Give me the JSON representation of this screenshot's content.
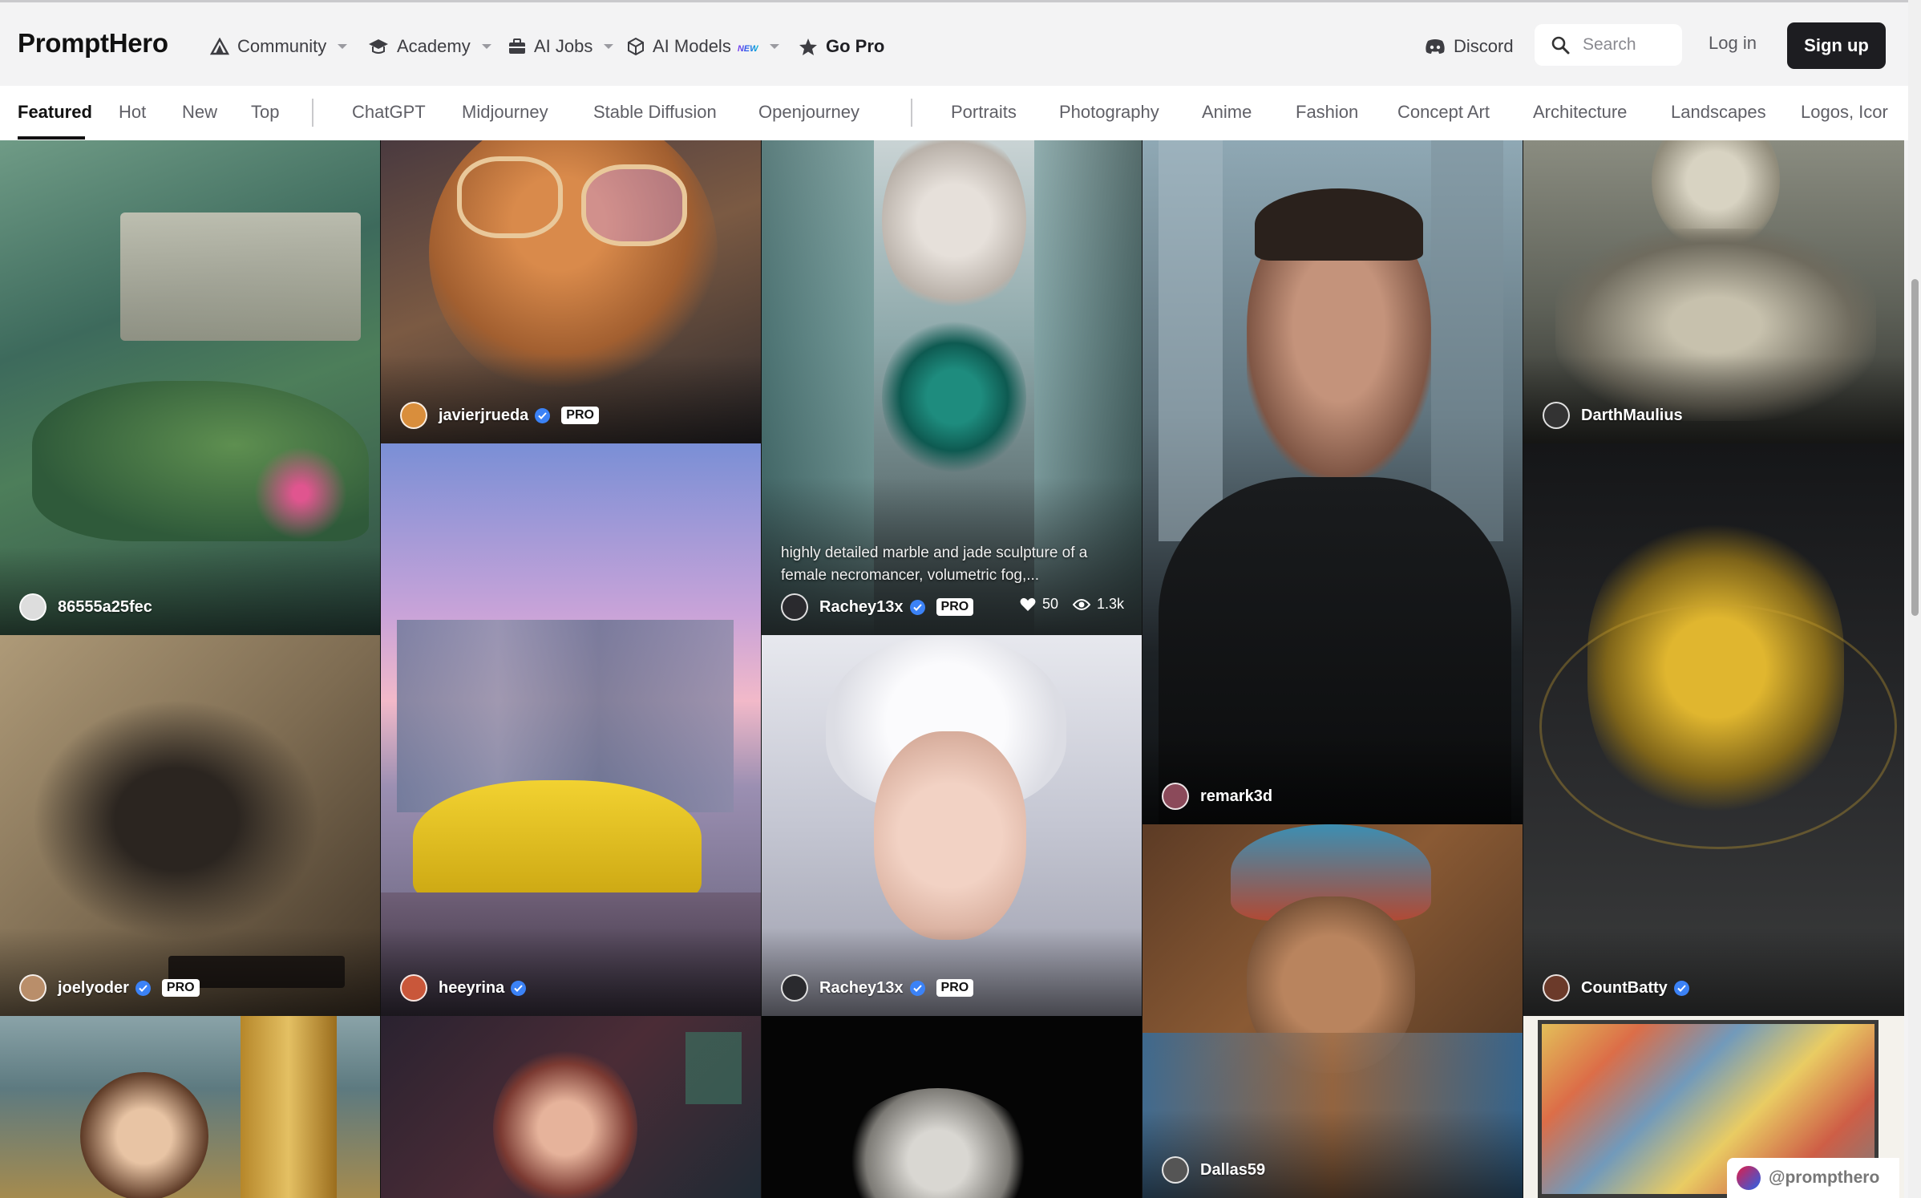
{
  "header": {
    "logo": "PromptHero",
    "nav": [
      {
        "label": "Community",
        "icon": "community-icon",
        "dropdown": true
      },
      {
        "label": "Academy",
        "icon": "academy-icon",
        "dropdown": true
      },
      {
        "label": "AI Jobs",
        "icon": "briefcase-icon",
        "dropdown": true
      },
      {
        "label": "AI Models",
        "icon": "cube-icon",
        "badge": "NEW",
        "dropdown": true
      },
      {
        "label": "Go Pro",
        "icon": "star-icon",
        "dropdown": false
      }
    ],
    "discord": "Discord",
    "search_placeholder": "Search",
    "login": "Log in",
    "signup": "Sign up"
  },
  "tabs": {
    "active": "Featured",
    "sort": [
      "Featured",
      "Hot",
      "New",
      "Top"
    ],
    "models": [
      "ChatGPT",
      "Midjourney",
      "Stable Diffusion",
      "Openjourney"
    ],
    "topics": [
      "Portraits",
      "Photography",
      "Anime",
      "Fashion",
      "Concept Art",
      "Architecture",
      "Landscapes",
      "Logos, Icor"
    ]
  },
  "cards": [
    {
      "author": "86555a25fec",
      "verified": false,
      "pro": false,
      "image": "cliffside villa landscape"
    },
    {
      "author": "joelyoder",
      "verified": true,
      "pro": true,
      "image": "ornate metal crow sculpture"
    },
    {
      "author": "",
      "image": "princess with golden tower"
    },
    {
      "author": "javierjrueda",
      "verified": true,
      "pro": true,
      "image": "fox with glasses"
    },
    {
      "author": "heeyrina",
      "verified": true,
      "pro": false,
      "image": "yellow sports car city sunset"
    },
    {
      "author": "",
      "image": "girl with horns"
    },
    {
      "author": "Rachey13x",
      "verified": true,
      "pro": true,
      "caption": "highly detailed marble and jade sculpture of a female necromancer, volumetric fog,...",
      "likes": "50",
      "views": "1.3k",
      "image": "woman with jade necklace"
    },
    {
      "author": "Rachey13x",
      "verified": true,
      "pro": true,
      "image": "woman with white hair"
    },
    {
      "author": "",
      "image": "elderly woman"
    },
    {
      "author": "remark3d",
      "verified": false,
      "pro": false,
      "image": "man in leather jacket"
    },
    {
      "author": "Dallas59",
      "verified": false,
      "pro": false,
      "image": "man with turban"
    },
    {
      "author": "DarthMaulius",
      "verified": false,
      "pro": false,
      "image": "skull sculpture"
    },
    {
      "author": "CountBatty",
      "verified": true,
      "pro": false,
      "image": "mechanical spider"
    },
    {
      "author": "",
      "image": "colorful collage"
    }
  ],
  "watermark": "@prompthero",
  "colors": {
    "accent": "#3b82f6",
    "dark_button": "#1d1d21"
  }
}
